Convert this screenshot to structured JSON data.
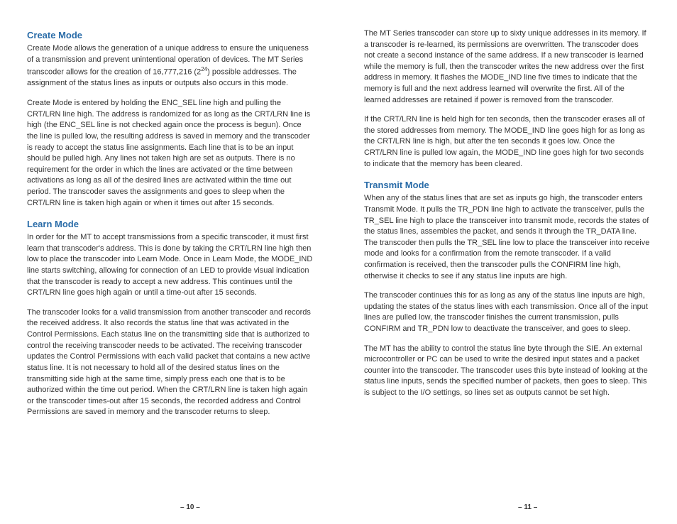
{
  "left": {
    "h1": "Create Mode",
    "p1a": "Create Mode allows the generation of a unique address to ensure the uniqueness of a transmission and prevent unintentional operation of devices. The MT Series transcoder allows for the creation of 16,777,216 (2",
    "p1sup": "24",
    "p1b": ") possible addresses. The assignment of the status lines as inputs or outputs also occurs in this mode.",
    "p2": "Create Mode is entered by holding the ENC_SEL line high and pulling the CRT/LRN line high. The address is randomized for as long as the CRT/LRN line is high (the ENC_SEL line is not checked again once the process is begun). Once the line is pulled low, the resulting address is saved in memory and the transcoder is ready to accept the status line assignments. Each line that is to be an input should be pulled high. Any lines not taken high are set as outputs. There is no requirement for the order in which the lines are activated or the time between activations as long as all of the desired lines are activated within the time out period. The transcoder saves the assignments and goes to sleep when the CRT/LRN line is taken high again or when it times out after 15 seconds.",
    "h2": "Learn Mode",
    "p3": "In order for the MT to accept transmissions from a specific transcoder, it must first learn that transcoder's address. This is done by taking the CRT/LRN line high then low to place the transcoder into Learn Mode. Once in Learn Mode, the MODE_IND line starts switching, allowing for connection of an LED to provide visual indication that the transcoder is ready to accept a new address. This continues until the CRT/LRN line goes high again or until a time-out after 15 seconds.",
    "p4": "The transcoder looks for a valid transmission from another transcoder and records the received address. It also records the status line that was activated in the Control Permissions. Each status line on the transmitting side that is authorized to control the receiving transcoder needs to be activated. The receiving transcoder updates the Control Permissions with each valid packet that contains a new active status line. It is not necessary to hold all of the desired status lines on the transmitting side high at the same time, simply press each one that is to be authorized within the time out period. When the CRT/LRN line is taken high again or the transcoder times-out after 15 seconds, the recorded address and Control Permissions are saved in memory and the transcoder returns to sleep.",
    "pagenum": "– 10 –"
  },
  "right": {
    "p1": "The MT Series transcoder can store up to sixty unique addresses in its memory. If a transcoder is re-learned, its permissions are overwritten. The transcoder does not create a second instance of the same address. If a new transcoder is learned while the memory is full, then the transcoder writes the new address over the first address in memory. It flashes the MODE_IND line five times to indicate that the memory is full and the next address learned will overwrite the first. All of the learned addresses are retained if power is removed from the transcoder.",
    "p2": "If the CRT/LRN line is held high for ten seconds, then the transcoder erases all of the stored addresses from memory. The MODE_IND line goes high for as long as the CRT/LRN line is high, but after the ten seconds it goes low. Once the CRT/LRN line is pulled low again, the MODE_IND line goes high for two seconds to indicate that the memory has been cleared.",
    "h1": "Transmit Mode",
    "p3": "When any of the status lines that are set as inputs go high, the transcoder enters Transmit Mode. It pulls the TR_PDN line high to activate the transceiver, pulls the TR_SEL line high to place the transceiver into transmit mode, records the states of the status lines, assembles the packet, and sends it through the TR_DATA line. The transcoder then pulls the TR_SEL line low to place the transceiver into receive mode and looks for a confirmation from the remote transcoder. If a valid confirmation is received, then the transcoder pulls the CONFIRM line high, otherwise it checks to see if any status line inputs are high.",
    "p4": "The transcoder continues this for as long as any of the status line inputs are high, updating the states of the status lines with each transmission. Once all of the input lines are pulled low, the transcoder finishes the current transmission, pulls CONFIRM and TR_PDN low to deactivate the transceiver, and goes to sleep.",
    "p5": "The MT has the ability to control the status line byte through the SIE. An external microcontroller or PC can be used to write the desired input states and a packet counter into the transcoder. The transcoder uses this byte instead of looking at the status line inputs, sends the specified number of packets, then goes to sleep. This is subject to the I/O settings, so lines set as outputs cannot be set high.",
    "pagenum": "– 11 –"
  }
}
